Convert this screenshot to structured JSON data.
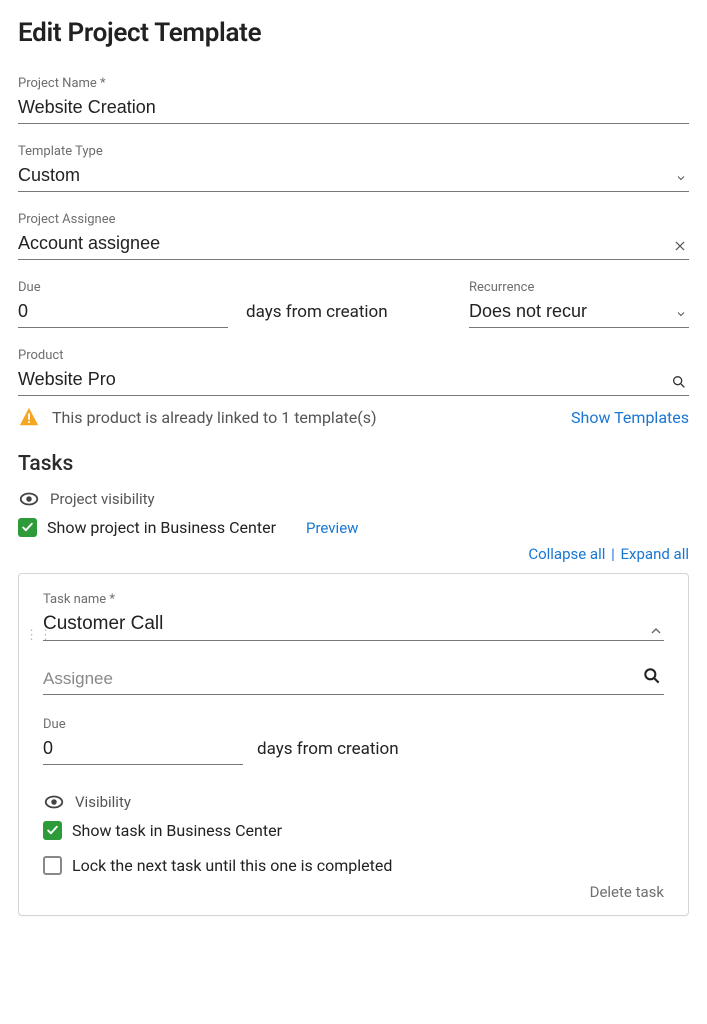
{
  "page_title": "Edit Project Template",
  "project_name": {
    "label": "Project Name *",
    "value": "Website Creation"
  },
  "template_type": {
    "label": "Template Type",
    "value": "Custom"
  },
  "project_assignee": {
    "label": "Project Assignee",
    "value": "Account assignee"
  },
  "due": {
    "label": "Due",
    "value": "0",
    "suffix": "days from creation"
  },
  "recurrence": {
    "label": "Recurrence",
    "value": "Does not recur"
  },
  "product": {
    "label": "Product",
    "value": "Website Pro"
  },
  "product_alert": {
    "text": "This product is already linked to 1 template(s)",
    "action": "Show Templates"
  },
  "tasks": {
    "heading": "Tasks",
    "visibility_label": "Project visibility",
    "show_in_bc": "Show project in Business Center",
    "preview": "Preview",
    "collapse_all": "Collapse all",
    "expand_all": "Expand all"
  },
  "task": {
    "name_label": "Task name *",
    "name_value": "Customer Call",
    "assignee_placeholder": "Assignee",
    "due_label": "Due",
    "due_value": "0",
    "due_suffix": "days from creation",
    "visibility_label": "Visibility",
    "show_task_bc": "Show task in Business Center",
    "lock_next": "Lock the next task until this one is completed",
    "delete": "Delete task"
  }
}
